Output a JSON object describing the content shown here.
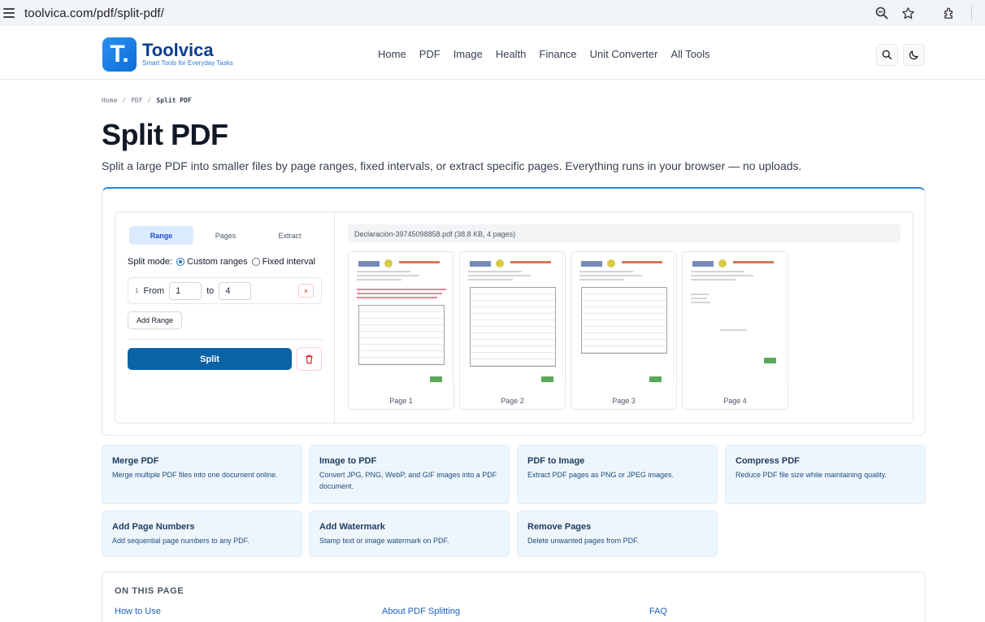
{
  "browser": {
    "url": "toolvica.com/pdf/split-pdf/"
  },
  "header": {
    "brand": "Toolvica",
    "tagline": "Smart Tools for Everyday Tasks",
    "nav": [
      "Home",
      "PDF",
      "Image",
      "Health",
      "Finance",
      "Unit Converter",
      "All Tools"
    ]
  },
  "breadcrumb": [
    "Home",
    "PDF",
    "Split PDF"
  ],
  "page": {
    "title": "Split PDF",
    "subtitle": "Split a large PDF into smaller files by page ranges, fixed intervals, or extract specific pages. Everything runs in your browser — no uploads."
  },
  "tool": {
    "tabs": [
      "Range",
      "Pages",
      "Extract"
    ],
    "active_tab": "Range",
    "mode_label": "Split mode:",
    "modes": [
      "Custom ranges",
      "Fixed interval"
    ],
    "selected_mode": "Custom ranges",
    "range": {
      "index": "1",
      "from_label": "From",
      "from_value": "1",
      "to_label": "to",
      "to_value": "4",
      "remove_glyph": "×"
    },
    "add_range_label": "Add Range",
    "split_label": "Split",
    "file_info": "Declaración-39745098858.pdf (38.8 KB, 4 pages)",
    "pages": [
      "Page 1",
      "Page 2",
      "Page 3",
      "Page 4"
    ]
  },
  "related": [
    {
      "title": "Merge PDF",
      "desc": "Merge multiple PDF files into one document online."
    },
    {
      "title": "Image to PDF",
      "desc": "Convert JPG, PNG, WebP, and GIF images into a PDF document."
    },
    {
      "title": "PDF to Image",
      "desc": "Extract PDF pages as PNG or JPEG images."
    },
    {
      "title": "Compress PDF",
      "desc": "Reduce PDF file size while maintaining quality."
    },
    {
      "title": "Add Page Numbers",
      "desc": "Add sequential page numbers to any PDF."
    },
    {
      "title": "Add Watermark",
      "desc": "Stamp text or image watermark on PDF."
    },
    {
      "title": "Remove Pages",
      "desc": "Delete unwanted pages from PDF."
    }
  ],
  "toc": {
    "title": "ON THIS PAGE",
    "links": [
      "How to Use",
      "About PDF Splitting",
      "FAQ"
    ]
  },
  "colors": {
    "brand": "#0d6ed8",
    "split_button": "#0b63a5",
    "active_tab_bg": "#dbeafe",
    "card_bg": "#eef6fd",
    "danger": "#dc2626"
  }
}
